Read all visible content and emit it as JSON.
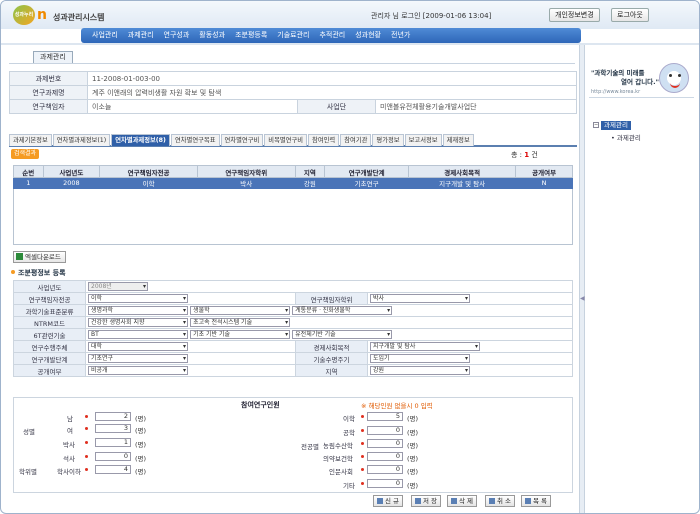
{
  "header": {
    "logo_text": "성과누리",
    "logo_n": "n",
    "system_title": "성과관리시스템",
    "user_info": "관리자 님 로그인 [2009-01-06 13:04]",
    "btn_info": "개인정보변경",
    "btn_logout": "로그아웃"
  },
  "nav": [
    "사업관리",
    "과제관리",
    "연구성과",
    "활동성과",
    "조분평등록",
    "기술료관리",
    "추적관리",
    "성과현황",
    "전년가"
  ],
  "page_tab": "과제관리",
  "info": {
    "task_no_label": "과제번호",
    "task_no": "11-2008-01-003-00",
    "task_name_label": "연구과제명",
    "task_name": "계주 이앤래의 압력비생활 자원 확보 및 탐색",
    "researcher_label": "연구책임자",
    "researcher": "이소늘",
    "project_label": "사업단",
    "project": "미앤볼유전체활용기술개발사업단"
  },
  "tabs": [
    "과제기본정보",
    "연차별과제정보(1)",
    "연차별과제정보(8)",
    "연차별연구목표",
    "연차별연구비",
    "비목별연구비",
    "참여인력",
    "참여기관",
    "평가정보",
    "보고서정보",
    "제재정보"
  ],
  "badge": "검색결과",
  "count": {
    "label": "총 :",
    "value": "1",
    "unit": "건"
  },
  "grid": {
    "headers": [
      "순번",
      "사업년도",
      "연구책임자전공",
      "연구책임자학위",
      "지역",
      "연구개발단계",
      "경제사회목적",
      "공개여부"
    ],
    "row": [
      "1",
      "2008",
      "이학",
      "박사",
      "강원",
      "기초연구",
      "지구개발 및 탐사",
      "N"
    ]
  },
  "excel_btn": "엑셀다운로드",
  "section_title": "조분평정보 등록",
  "form": {
    "year_label": "사업년도",
    "year": "2008년",
    "major_label": "연구책임자전공",
    "major": "이학",
    "degree_label": "연구책임자학위",
    "degree": "박사",
    "std_label": "과학기술표준분류",
    "std1": "생명과학",
    "std2": "생물학",
    "std3": "계통분류ㆍ진화생물학",
    "ntrm_label": "NTRM코드",
    "ntrm1": "건강한 생명사회 지향",
    "ntrm2": "초고속 전석시스템 기술",
    "tech6_label": "6T관련기술",
    "tech6_1": "BT",
    "tech6_2": "기초 기반 기술",
    "tech6_3": "유전체기반 기술",
    "exec_label": "연구수행주체",
    "exec": "대학",
    "econ_label": "경제사회목적",
    "econ": "지구개발 및 탐사",
    "stage_label": "연구개발단계",
    "stage": "기초연구",
    "cycle_label": "기술수명주기",
    "cycle": "도입기",
    "open_label": "공개여부",
    "open": "비공개",
    "region_label": "지역",
    "region": "강원"
  },
  "participants": {
    "title": "참여연구인원",
    "note": "※ 해당인원 없을시 0 입력",
    "gender_label": "성별",
    "degree_group_label": "학위별",
    "major_group_label": "전공별",
    "unit": "(명)",
    "male_label": "남",
    "male": "2",
    "female_label": "여",
    "female": "3",
    "phd_label": "박사",
    "phd": "1",
    "master_label": "석사",
    "master": "0",
    "bachelor_label": "학사이하",
    "bachelor": "4",
    "sci_label": "이학",
    "sci": "5",
    "eng_label": "공학",
    "eng": "0",
    "agri_label": "농림수산학",
    "agri": "0",
    "med_label": "의약보건학",
    "med": "0",
    "hum_label": "인문사회",
    "hum": "0",
    "etc_label": "기타",
    "etc": "0"
  },
  "buttons": {
    "new": "신 규",
    "save": "저 장",
    "delete": "삭 제",
    "cancel": "취 소",
    "list": "목 록"
  },
  "right": {
    "slogan1": "\"과학기술의 미래를",
    "slogan2": "열어 갑니다.\"",
    "slogan_url": "http://www.korea.kr",
    "tree_root": "과제관리",
    "tree_child": "과제관리"
  },
  "colors": {
    "nav": "#2e66b8",
    "active_tab": "#2f5fa8",
    "selected_row": "#4a74b8",
    "accent": "#f59b23"
  }
}
